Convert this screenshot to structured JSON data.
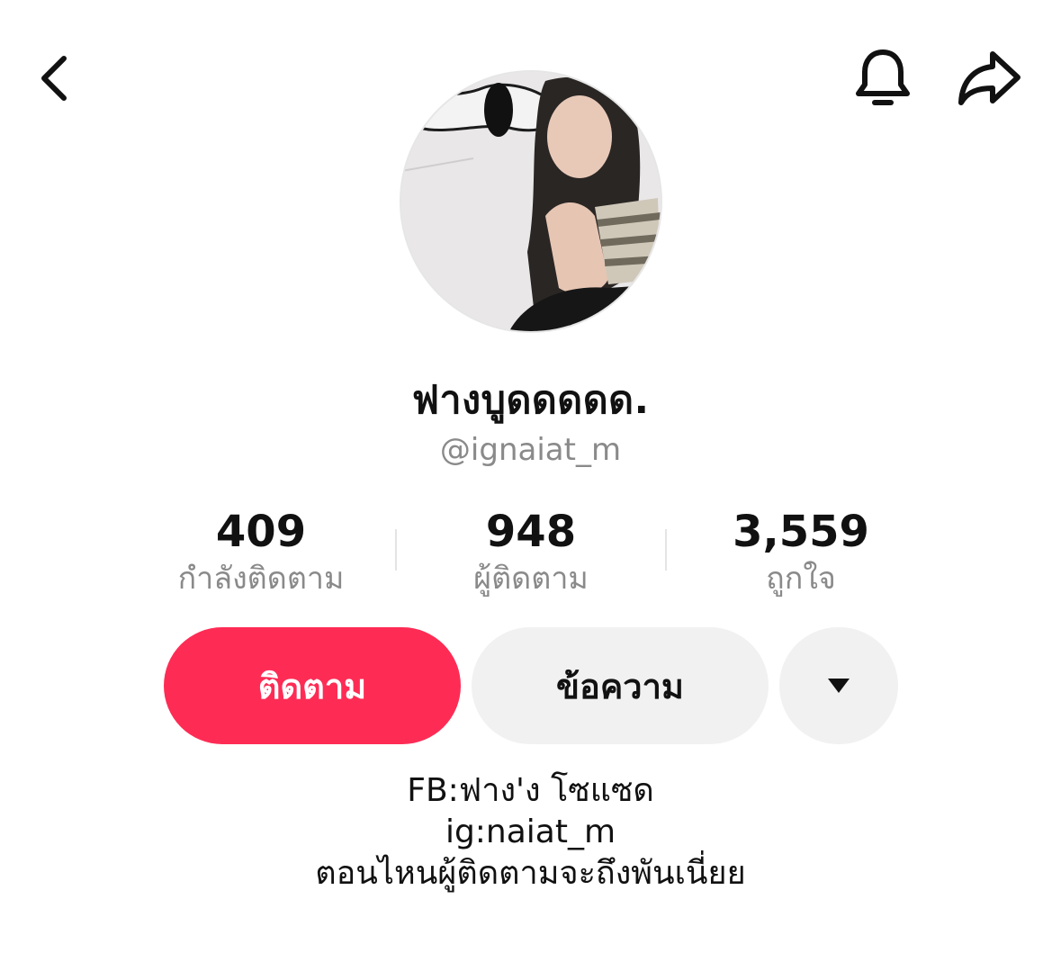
{
  "header": {
    "back_icon": "chevron-left-icon",
    "bell_icon": "bell-icon",
    "share_icon": "share-arrow-icon"
  },
  "profile": {
    "display_name": "ฟางบูดดดดด.",
    "username": "@ignaiat_m"
  },
  "stats": [
    {
      "value": "409",
      "label": "กำลังติดตาม"
    },
    {
      "value": "948",
      "label": "ผู้ติดตาม"
    },
    {
      "value": "3,559",
      "label": "ถูกใจ"
    }
  ],
  "actions": {
    "follow_label": "ติดตาม",
    "message_label": "ข้อความ",
    "more_icon": "caret-down-icon"
  },
  "bio": {
    "lines": [
      "FB:ฟาง'ง โซแซด",
      "ig:naiat_m",
      "ตอนไหนผู้ติดตามจะถึงพันเนี่ยย"
    ]
  },
  "colors": {
    "accent": "#fe2c55",
    "secondary_button": "#f1f1f2",
    "muted_text": "#8a8a8a"
  }
}
